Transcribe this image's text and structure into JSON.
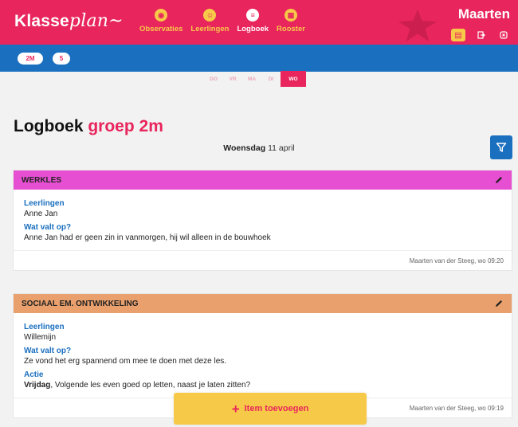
{
  "header": {
    "logo_text": "Klasse",
    "logo_script": "plan",
    "nav": [
      {
        "label": "Observaties",
        "icon": "eye-icon",
        "glyph": "◉"
      },
      {
        "label": "Leerlingen",
        "icon": "students-icon",
        "glyph": "☺"
      },
      {
        "label": "Logboek",
        "icon": "logbook-icon",
        "glyph": "≡"
      },
      {
        "label": "Rooster",
        "icon": "schedule-icon",
        "glyph": "▦"
      }
    ],
    "active_nav": "Logboek",
    "user_name": "Maarten"
  },
  "groups": {
    "items": [
      "2M",
      "5"
    ],
    "active": "2M"
  },
  "days": {
    "items": [
      "DO",
      "VR",
      "MA",
      "DI",
      "WO"
    ],
    "active": "WO"
  },
  "page": {
    "title_prefix": "Logboek",
    "title_group": "groep 2m",
    "date_day": "Woensdag",
    "date_rest": "11 april"
  },
  "entries": [
    {
      "category": "WERKLES",
      "color": "#e64fd1",
      "fields": [
        {
          "label": "Leerlingen",
          "value": "Anne Jan"
        },
        {
          "label": "Wat valt op?",
          "value": "Anne Jan had er geen zin in vanmorgen, hij wil alleen in de bouwhoek"
        }
      ],
      "footer": "Maarten van der Steeg, wo 09:20"
    },
    {
      "category": "SOCIAAL EM. ONTWIKKELING",
      "color": "#e9a06c",
      "fields": [
        {
          "label": "Leerlingen",
          "value": "Willemijn"
        },
        {
          "label": "Wat valt op?",
          "value": "Ze vond het erg spannend om mee te doen met deze les."
        },
        {
          "label": "Actie",
          "value_bold": "Vrijdag",
          "value": ", Volgende les even goed op letten, naast je laten zitten?"
        }
      ],
      "footer": "Maarten van der Steeg, wo 09:19"
    }
  ],
  "add_button": {
    "label": "Item toevoegen"
  },
  "colors": {
    "brand_pink": "#e8255c",
    "brand_blue": "#1a6fbf",
    "brand_yellow": "#f7c948"
  }
}
